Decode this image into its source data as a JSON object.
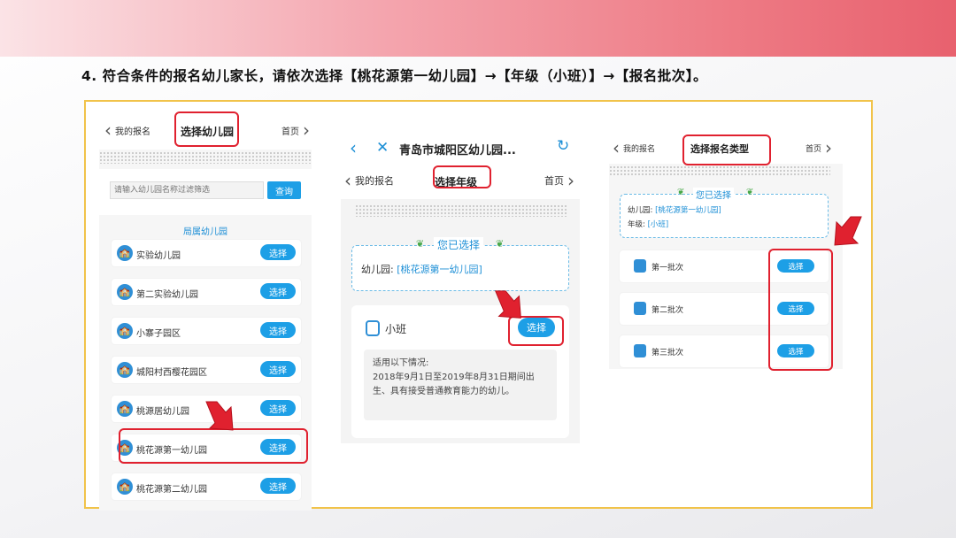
{
  "instruction": "4. 符合条件的报名幼儿家长，请依次选择【桃花源第一幼儿园】→【年级（小班）】→【报名批次】。",
  "screen1": {
    "back_label": "我的报名",
    "title": "选择幼儿园",
    "home_label": "首页",
    "search_placeholder": "请输入幼儿园名称过滤筛选",
    "search_button": "查询",
    "section_title": "局属幼儿园",
    "select_label": "选择",
    "schools": [
      "实验幼儿园",
      "第二实验幼儿园",
      "小寨子园区",
      "城阳村西樱花园区",
      "桃源居幼儿园",
      "桃花源第一幼儿园",
      "桃花源第二幼儿园"
    ]
  },
  "screen2": {
    "browser_title": "青岛市城阳区幼儿园...",
    "back_label": "我的报名",
    "title": "选择年级",
    "home_label": "首页",
    "selected_heading": "您已选择",
    "kindergarten_label": "幼儿园:",
    "kindergarten_value": "[桃花源第一幼儿园]",
    "grade_name": "小班",
    "select_label": "选择",
    "info_line1": "适用以下情况:",
    "info_line2": "2018年9月1日至2019年8月31日期间出",
    "info_line3": "生、具有接受普通教育能力的幼儿。"
  },
  "screen3": {
    "back_label": "我的报名",
    "title": "选择报名类型",
    "home_label": "首页",
    "selected_heading": "您已选择",
    "kindergarten_label": "幼儿园:",
    "kindergarten_value": "[桃花源第一幼儿园]",
    "grade_label": "年级:",
    "grade_value": "[小班]",
    "select_label": "选择",
    "batches": [
      "第一批次",
      "第二批次",
      "第三批次"
    ]
  },
  "colors": {
    "accent_blue": "#1d9fe6",
    "highlight_red": "#e0212f",
    "frame_gold": "#f1c34a"
  }
}
